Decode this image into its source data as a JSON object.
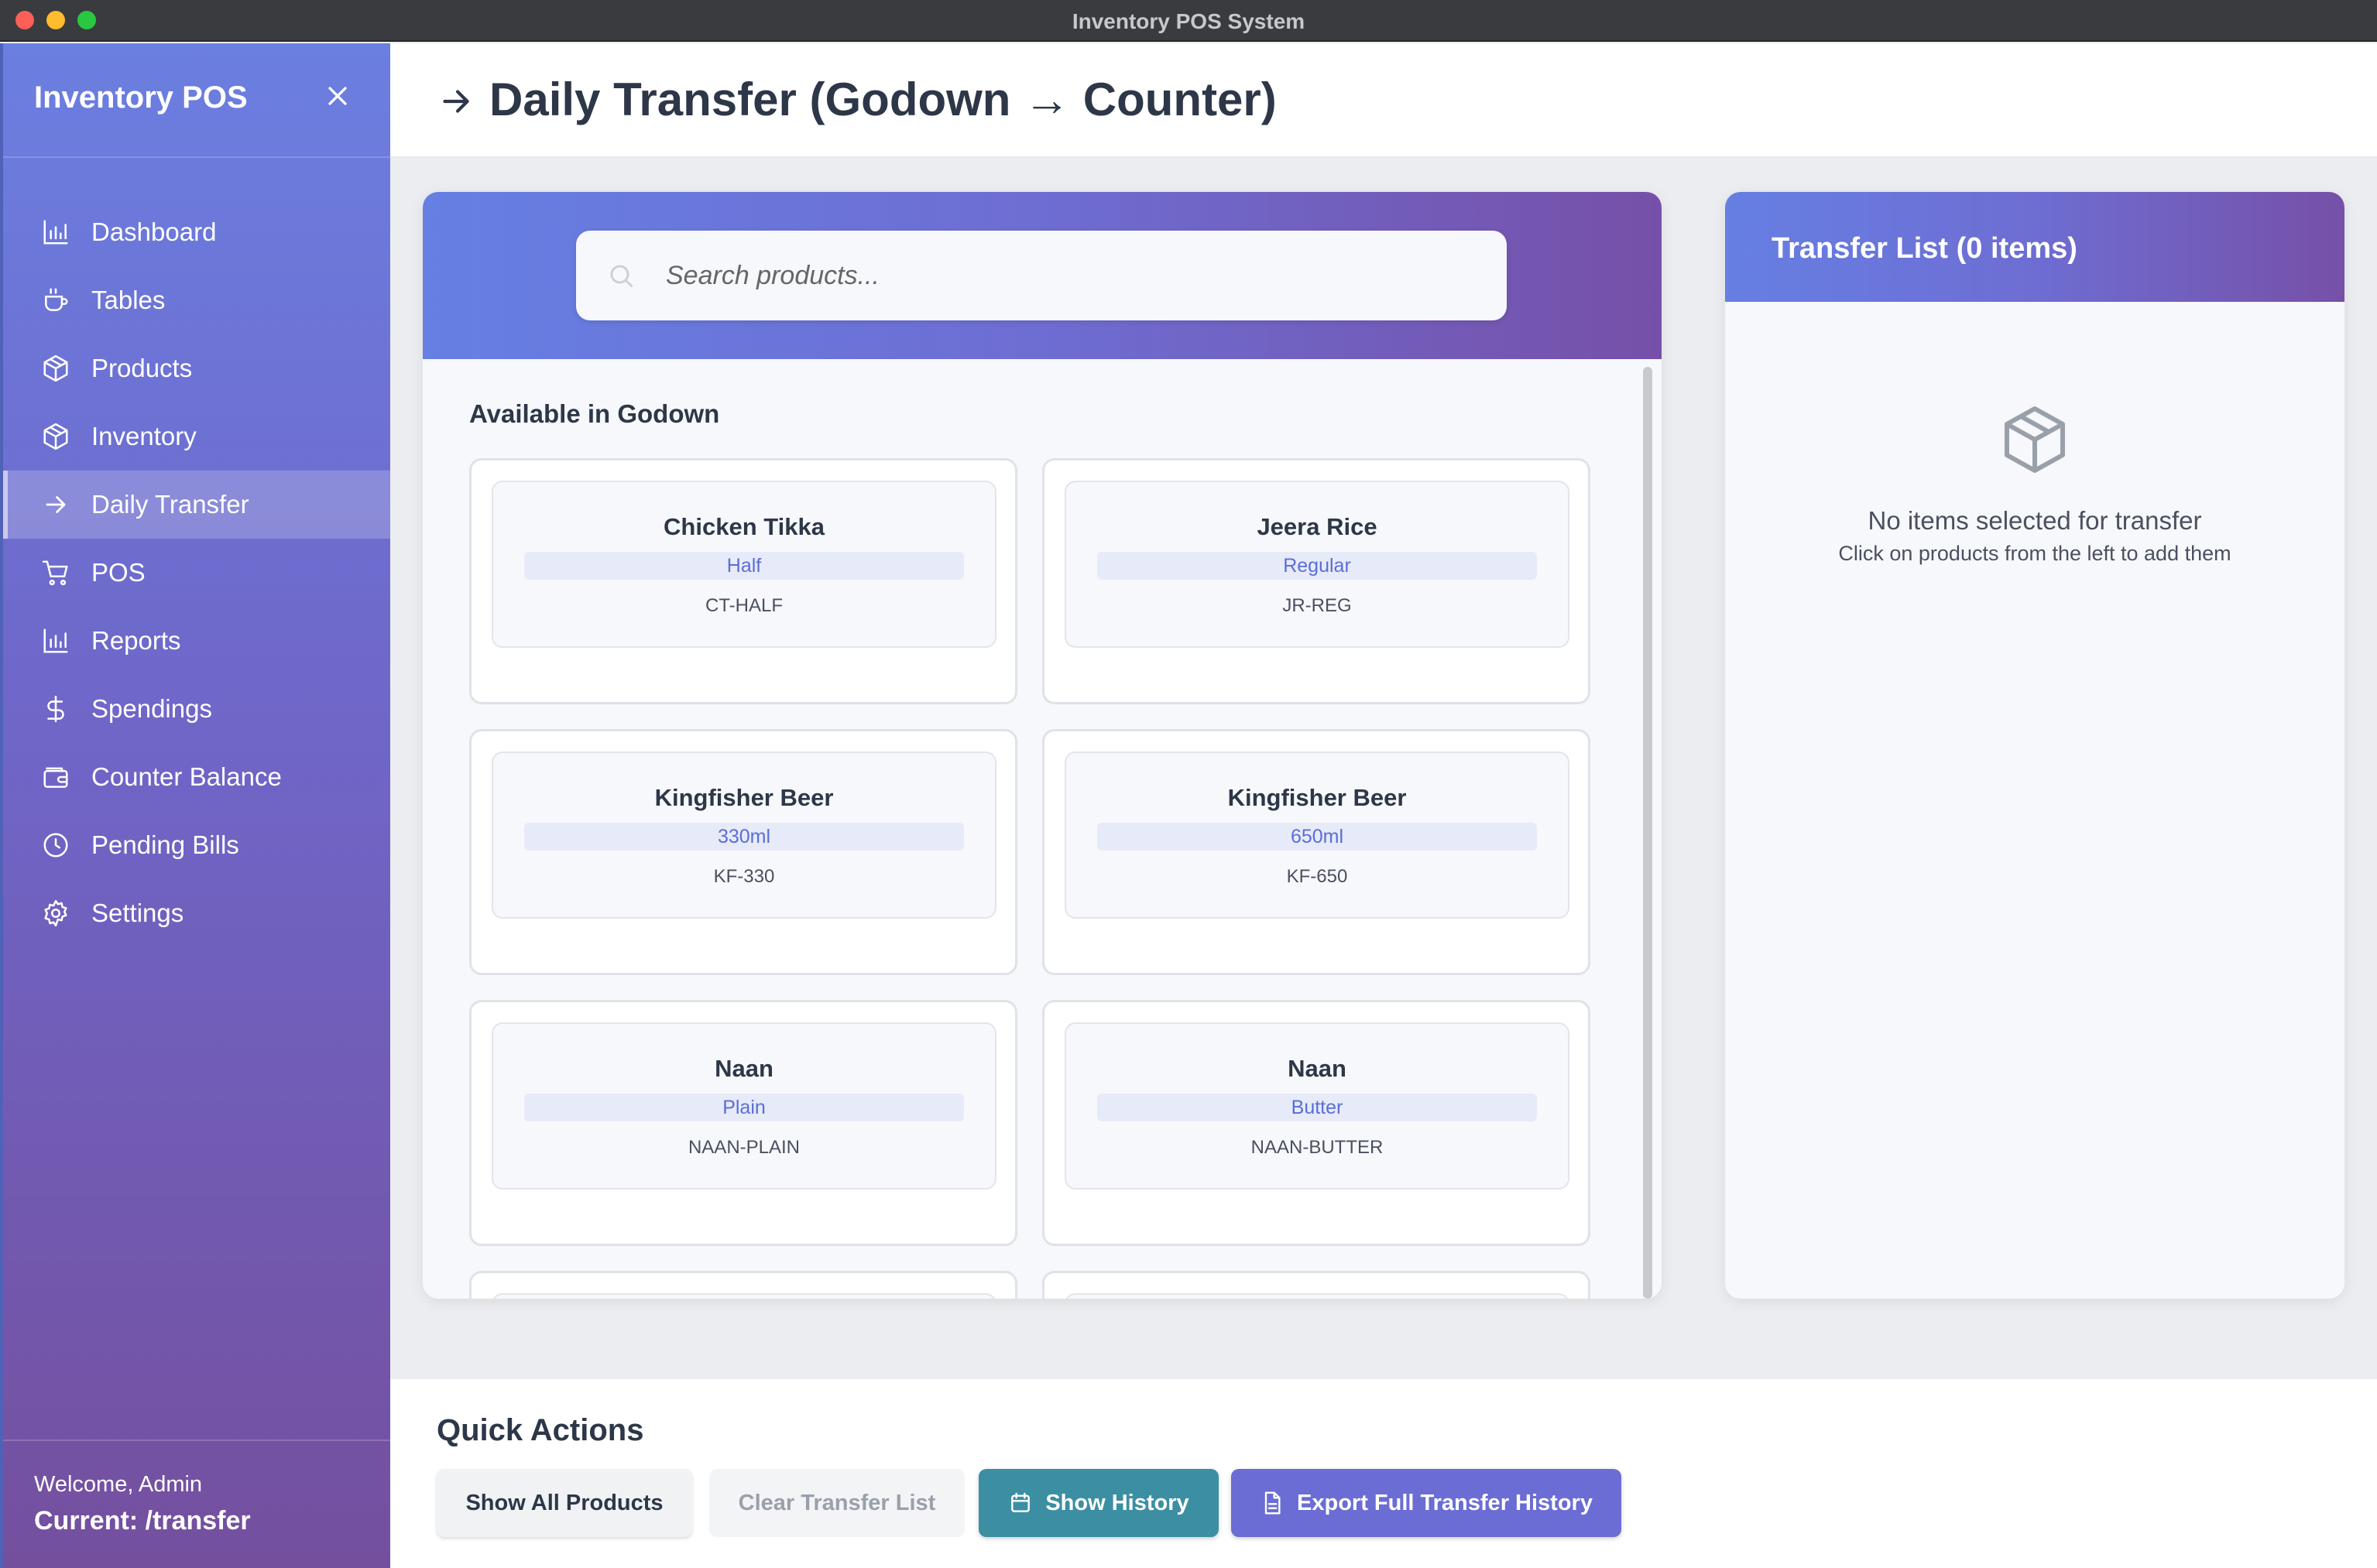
{
  "window": {
    "title": "Inventory POS System"
  },
  "sidebar": {
    "brand": "Inventory POS",
    "items": [
      {
        "label": "Dashboard",
        "icon": "bar-chart-icon"
      },
      {
        "label": "Tables",
        "icon": "cup-icon"
      },
      {
        "label": "Products",
        "icon": "box-icon"
      },
      {
        "label": "Inventory",
        "icon": "box-icon"
      },
      {
        "label": "Daily Transfer",
        "icon": "arrow-right-icon",
        "active": true
      },
      {
        "label": "POS",
        "icon": "cart-icon"
      },
      {
        "label": "Reports",
        "icon": "bar-chart-icon"
      },
      {
        "label": "Spendings",
        "icon": "dollar-icon"
      },
      {
        "label": "Counter Balance",
        "icon": "wallet-icon"
      },
      {
        "label": "Pending Bills",
        "icon": "clock-icon"
      },
      {
        "label": "Settings",
        "icon": "gear-icon"
      }
    ],
    "welcome": "Welcome, Admin",
    "current": "Current: /transfer"
  },
  "header": {
    "title": "Daily Transfer (Godown → Counter)"
  },
  "search": {
    "placeholder": "Search products..."
  },
  "godown": {
    "section_label": "Available in Godown",
    "products": [
      {
        "name": "Chicken Tikka",
        "variant": "Half",
        "sku": "CT-HALF"
      },
      {
        "name": "Jeera Rice",
        "variant": "Regular",
        "sku": "JR-REG"
      },
      {
        "name": "Kingfisher Beer",
        "variant": "330ml",
        "sku": "KF-330"
      },
      {
        "name": "Kingfisher Beer",
        "variant": "650ml",
        "sku": "KF-650"
      },
      {
        "name": "Naan",
        "variant": "Plain",
        "sku": "NAAN-PLAIN"
      },
      {
        "name": "Naan",
        "variant": "Butter",
        "sku": "NAAN-BUTTER"
      }
    ]
  },
  "transfer_list": {
    "title": "Transfer List (0 items)",
    "empty_title": "No items selected for transfer",
    "empty_hint": "Click on products from the left to add them"
  },
  "quick_actions": {
    "title": "Quick Actions",
    "show_all": "Show All Products",
    "clear": "Clear Transfer List",
    "history": "Show History",
    "export": "Export Full Transfer History"
  },
  "colors": {
    "sidebar_top": "#6b7fe0",
    "sidebar_bottom": "#744f9e",
    "history_button": "#3c8fa3",
    "export_button": "#6b6dd4",
    "variant_text": "#5a6ed6"
  }
}
